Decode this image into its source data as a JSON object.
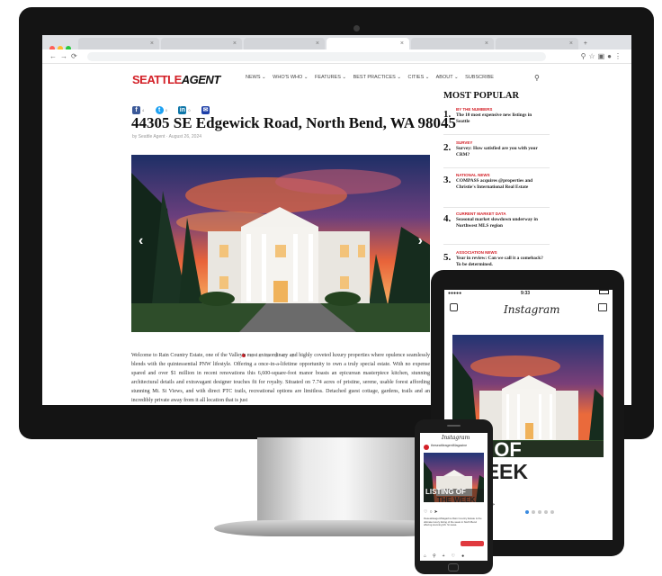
{
  "site": {
    "logo_part1": "SEATTLE",
    "logo_part2": "AGENT",
    "nav": [
      "NEWS ⌄",
      "WHO'S WHO ⌄",
      "FEATURES ⌄",
      "BEST PRACTICES ⌄",
      "CITIES ⌄",
      "ABOUT ⌄",
      "SUBSCRIBE"
    ],
    "search_icon": "search-icon"
  },
  "article": {
    "share_counts": [
      "4",
      "0",
      "0"
    ],
    "headline": "44305 SE Edgewick Road, North Bend, WA 98045",
    "byline": "by Seattle Agent  ·  August 26, 2024",
    "body": "Welcome to Rain Country Estate, one of the Valley's most extraordinary and highly coveted luxury properties where opulence seamlessly blends with the quintessential PNW lifestyle. Offering a once-in-a-lifetime opportunity to own a truly special estate. With no expense spared and over $1 million in recent renovations this 6,600-square-foot manor boasts an epicurean masterpiece kitchen, stunning architectural details and extravagant designer touches fit for royalty. Situated on 7.74 acres of pristine, serene, usable forest affording stunning Mt. Si Views, and with direct PTC trails, recreational options are limitless. Detached guest cottage, gardens, trails and an incredibly private away from it all location that is just"
  },
  "sidebar": {
    "title": "MOST POPULAR",
    "items": [
      {
        "num": "1.",
        "category": "BY THE NUMBERS",
        "text": "The 10 most expensive new listings in Seattle"
      },
      {
        "num": "2.",
        "category": "SURVEY",
        "text": "Survey: How satisfied are you with your CRM?"
      },
      {
        "num": "3.",
        "category": "NATIONAL NEWS",
        "text": "COMPASS acquires @properties and Christie's International Real Estate"
      },
      {
        "num": "4.",
        "category": "CURRENT MARKET DATA",
        "text": "Seasonal market slowdown underway in Northwest MLS region"
      },
      {
        "num": "5.",
        "category": "ASSOCIATION NEWS",
        "text": "Year in review: Can we call it a comeback? To be determined."
      }
    ]
  },
  "tablet": {
    "carrier": "●●●●●  ",
    "time": "9:33",
    "app_name": "Instagram",
    "overlay_line1": "ING OF",
    "overlay_line2": "WEEK"
  },
  "phone": {
    "app_name": "Instagram",
    "account": "theseattleagentMagazine",
    "overlay_line1": "LISTING OF",
    "overlay_line2": "THE WEEK",
    "caption": "theseattleagentMagazine Rain Country Estate is the ultimate luxury listing of the week in North Bend offering stunning Mt. Si views."
  },
  "colors": {
    "brand_red": "#d32027",
    "instagram_dot": "#3a8be0"
  }
}
